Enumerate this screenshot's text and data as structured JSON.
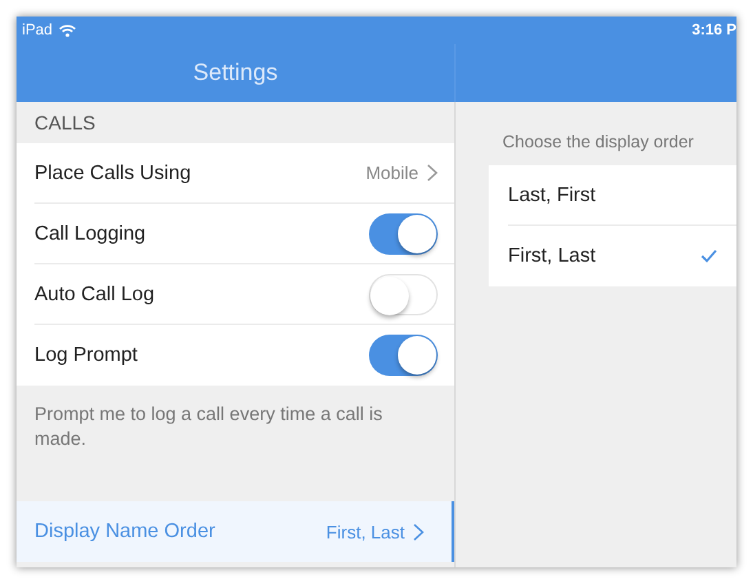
{
  "status_bar": {
    "device": "iPad",
    "time": "3:16 P"
  },
  "master": {
    "title": "Settings",
    "section": "CALLS",
    "rows": [
      {
        "kind": "link",
        "label": "Place Calls Using",
        "value": "Mobile"
      },
      {
        "kind": "toggle",
        "label": "Call Logging",
        "on": true
      },
      {
        "kind": "toggle",
        "label": "Auto Call Log",
        "on": false
      },
      {
        "kind": "toggle",
        "label": "Log Prompt",
        "on": true
      }
    ],
    "footer": "Prompt me to log a call every time a call is made.",
    "nav_item": {
      "label": "Display Name Order",
      "value": "First, Last",
      "selected": true
    }
  },
  "detail": {
    "header": "Choose the display order",
    "options": [
      {
        "label": "Last, First",
        "selected": false
      },
      {
        "label": "First, Last",
        "selected": true
      }
    ]
  }
}
